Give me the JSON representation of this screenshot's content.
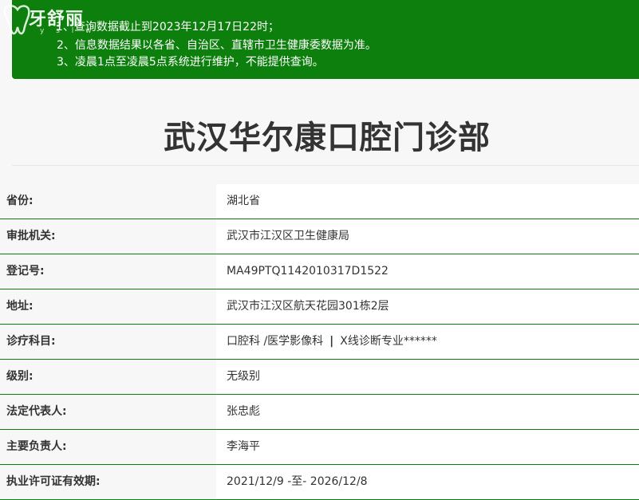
{
  "notice": {
    "lines": [
      "1、查询数据截止到2023年12月17日22时；",
      "2、信息数据结果以各省、自治区、直辖市卫生健康委数据为准。",
      "3、凌晨1点至凌晨5点系统进行维护，不能提供查询。"
    ],
    "background": "#0c7f0c"
  },
  "logo": {
    "text": "牙舒丽",
    "sub": "y s l w"
  },
  "clinic": {
    "title": "武汉华尔康口腔门诊部"
  },
  "info": {
    "province": {
      "label": "省份:",
      "value": "湖北省"
    },
    "authority": {
      "label": "审批机关:",
      "value": "武汉市江汉区卫生健康局"
    },
    "reg_no": {
      "label": "登记号:",
      "value": "MA49PTQ1142010317D1522"
    },
    "address": {
      "label": "地址:",
      "value": "武汉市江汉区航天花园301栋2层"
    },
    "departments": {
      "label": "诊疗科目:",
      "part1": "口腔科 /医学影像科",
      "separator": "|",
      "part2": "X线诊断专业******"
    },
    "level": {
      "label": "级别:",
      "value": "无级别"
    },
    "legal_rep": {
      "label": "法定代表人:",
      "value": "张忠彪"
    },
    "principal": {
      "label": "主要负责人:",
      "value": "李海平"
    },
    "validity": {
      "label": "执业许可证有效期:",
      "value": "2021/12/9 -至- 2026/12/8"
    }
  },
  "colors": {
    "accent_green": "#0c7f0c",
    "text": "#333333"
  }
}
